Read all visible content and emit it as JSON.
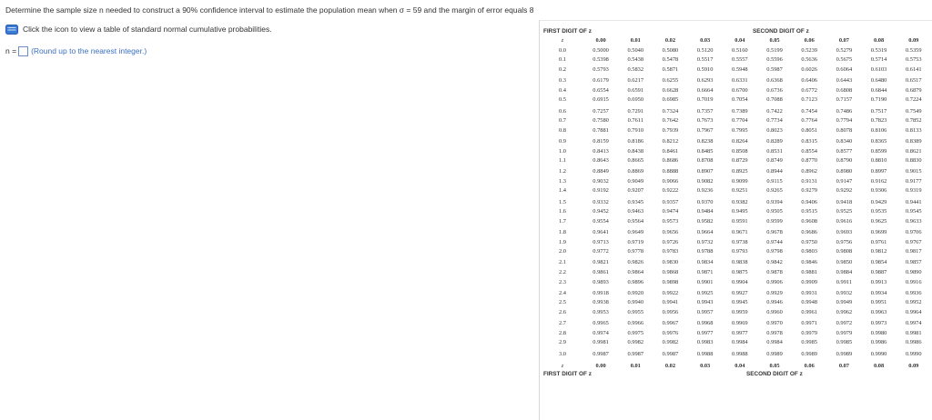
{
  "question": "Determine the sample size n needed to construct a 90% confidence interval to estimate the population mean when σ = 59 and the margin of error equals 8",
  "hint": "Click the icon to view a table of standard normal cumulative probabilities.",
  "answer": {
    "label": "n =",
    "value": "",
    "hint": "(Round up to the nearest integer.)"
  },
  "table": {
    "first_digit_label": "FIRST DIGIT OF z",
    "second_digit_label": "SECOND DIGIT OF z",
    "z_symbol": "z",
    "columns": [
      "0.00",
      "0.01",
      "0.02",
      "0.03",
      "0.04",
      "0.05",
      "0.06",
      "0.07",
      "0.08",
      "0.09"
    ],
    "rows": [
      {
        "z": "0.0",
        "vals": [
          "0.5000",
          "0.5040",
          "0.5080",
          "0.5120",
          "0.5160",
          "0.5199",
          "0.5239",
          "0.5279",
          "0.5319",
          "0.5359"
        ]
      },
      {
        "z": "0.1",
        "vals": [
          "0.5398",
          "0.5438",
          "0.5478",
          "0.5517",
          "0.5557",
          "0.5596",
          "0.5636",
          "0.5675",
          "0.5714",
          "0.5753"
        ]
      },
      {
        "z": "0.2",
        "vals": [
          "0.5793",
          "0.5832",
          "0.5871",
          "0.5910",
          "0.5948",
          "0.5987",
          "0.6026",
          "0.6064",
          "0.6103",
          "0.6141"
        ]
      },
      {
        "z": "0.3",
        "vals": [
          "0.6179",
          "0.6217",
          "0.6255",
          "0.6293",
          "0.6331",
          "0.6368",
          "0.6406",
          "0.6443",
          "0.6480",
          "0.6517"
        ]
      },
      {
        "z": "0.4",
        "vals": [
          "0.6554",
          "0.6591",
          "0.6628",
          "0.6664",
          "0.6700",
          "0.6736",
          "0.6772",
          "0.6808",
          "0.6844",
          "0.6879"
        ]
      },
      {
        "z": "0.5",
        "vals": [
          "0.6915",
          "0.6950",
          "0.6985",
          "0.7019",
          "0.7054",
          "0.7088",
          "0.7123",
          "0.7157",
          "0.7190",
          "0.7224"
        ]
      },
      {
        "z": "0.6",
        "vals": [
          "0.7257",
          "0.7291",
          "0.7324",
          "0.7357",
          "0.7389",
          "0.7422",
          "0.7454",
          "0.7486",
          "0.7517",
          "0.7549"
        ]
      },
      {
        "z": "0.7",
        "vals": [
          "0.7580",
          "0.7611",
          "0.7642",
          "0.7673",
          "0.7704",
          "0.7734",
          "0.7764",
          "0.7794",
          "0.7823",
          "0.7852"
        ]
      },
      {
        "z": "0.8",
        "vals": [
          "0.7881",
          "0.7910",
          "0.7939",
          "0.7967",
          "0.7995",
          "0.8023",
          "0.8051",
          "0.8078",
          "0.8106",
          "0.8133"
        ]
      },
      {
        "z": "0.9",
        "vals": [
          "0.8159",
          "0.8186",
          "0.8212",
          "0.8238",
          "0.8264",
          "0.8289",
          "0.8315",
          "0.8340",
          "0.8365",
          "0.8389"
        ]
      },
      {
        "z": "1.0",
        "vals": [
          "0.8413",
          "0.8438",
          "0.8461",
          "0.8485",
          "0.8508",
          "0.8531",
          "0.8554",
          "0.8577",
          "0.8599",
          "0.8621"
        ]
      },
      {
        "z": "1.1",
        "vals": [
          "0.8643",
          "0.8665",
          "0.8686",
          "0.8708",
          "0.8729",
          "0.8749",
          "0.8770",
          "0.8790",
          "0.8810",
          "0.8830"
        ]
      },
      {
        "z": "1.2",
        "vals": [
          "0.8849",
          "0.8869",
          "0.8888",
          "0.8907",
          "0.8925",
          "0.8944",
          "0.8962",
          "0.8980",
          "0.8997",
          "0.9015"
        ]
      },
      {
        "z": "1.3",
        "vals": [
          "0.9032",
          "0.9049",
          "0.9066",
          "0.9082",
          "0.9099",
          "0.9115",
          "0.9131",
          "0.9147",
          "0.9162",
          "0.9177"
        ]
      },
      {
        "z": "1.4",
        "vals": [
          "0.9192",
          "0.9207",
          "0.9222",
          "0.9236",
          "0.9251",
          "0.9265",
          "0.9279",
          "0.9292",
          "0.9306",
          "0.9319"
        ]
      },
      {
        "z": "1.5",
        "vals": [
          "0.9332",
          "0.9345",
          "0.9357",
          "0.9370",
          "0.9382",
          "0.9394",
          "0.9406",
          "0.9418",
          "0.9429",
          "0.9441"
        ]
      },
      {
        "z": "1.6",
        "vals": [
          "0.9452",
          "0.9463",
          "0.9474",
          "0.9484",
          "0.9495",
          "0.9505",
          "0.9515",
          "0.9525",
          "0.9535",
          "0.9545"
        ]
      },
      {
        "z": "1.7",
        "vals": [
          "0.9554",
          "0.9564",
          "0.9573",
          "0.9582",
          "0.9591",
          "0.9599",
          "0.9608",
          "0.9616",
          "0.9625",
          "0.9633"
        ]
      },
      {
        "z": "1.8",
        "vals": [
          "0.9641",
          "0.9649",
          "0.9656",
          "0.9664",
          "0.9671",
          "0.9678",
          "0.9686",
          "0.9693",
          "0.9699",
          "0.9706"
        ]
      },
      {
        "z": "1.9",
        "vals": [
          "0.9713",
          "0.9719",
          "0.9726",
          "0.9732",
          "0.9738",
          "0.9744",
          "0.9750",
          "0.9756",
          "0.9761",
          "0.9767"
        ]
      },
      {
        "z": "2.0",
        "vals": [
          "0.9772",
          "0.9778",
          "0.9783",
          "0.9788",
          "0.9793",
          "0.9798",
          "0.9803",
          "0.9808",
          "0.9812",
          "0.9817"
        ]
      },
      {
        "z": "2.1",
        "vals": [
          "0.9821",
          "0.9826",
          "0.9830",
          "0.9834",
          "0.9838",
          "0.9842",
          "0.9846",
          "0.9850",
          "0.9854",
          "0.9857"
        ]
      },
      {
        "z": "2.2",
        "vals": [
          "0.9861",
          "0.9864",
          "0.9868",
          "0.9871",
          "0.9875",
          "0.9878",
          "0.9881",
          "0.9884",
          "0.9887",
          "0.9890"
        ]
      },
      {
        "z": "2.3",
        "vals": [
          "0.9893",
          "0.9896",
          "0.9898",
          "0.9901",
          "0.9904",
          "0.9906",
          "0.9909",
          "0.9911",
          "0.9913",
          "0.9916"
        ]
      },
      {
        "z": "2.4",
        "vals": [
          "0.9918",
          "0.9920",
          "0.9922",
          "0.9925",
          "0.9927",
          "0.9929",
          "0.9931",
          "0.9932",
          "0.9934",
          "0.9936"
        ]
      },
      {
        "z": "2.5",
        "vals": [
          "0.9938",
          "0.9940",
          "0.9941",
          "0.9943",
          "0.9945",
          "0.9946",
          "0.9948",
          "0.9949",
          "0.9951",
          "0.9952"
        ]
      },
      {
        "z": "2.6",
        "vals": [
          "0.9953",
          "0.9955",
          "0.9956",
          "0.9957",
          "0.9959",
          "0.9960",
          "0.9961",
          "0.9962",
          "0.9963",
          "0.9964"
        ]
      },
      {
        "z": "2.7",
        "vals": [
          "0.9965",
          "0.9966",
          "0.9967",
          "0.9968",
          "0.9969",
          "0.9970",
          "0.9971",
          "0.9972",
          "0.9973",
          "0.9974"
        ]
      },
      {
        "z": "2.8",
        "vals": [
          "0.9974",
          "0.9975",
          "0.9976",
          "0.9977",
          "0.9977",
          "0.9978",
          "0.9979",
          "0.9979",
          "0.9980",
          "0.9981"
        ]
      },
      {
        "z": "2.9",
        "vals": [
          "0.9981",
          "0.9982",
          "0.9982",
          "0.9983",
          "0.9984",
          "0.9984",
          "0.9985",
          "0.9985",
          "0.9986",
          "0.9986"
        ]
      },
      {
        "z": "3.0",
        "vals": [
          "0.9987",
          "0.9987",
          "0.9987",
          "0.9988",
          "0.9988",
          "0.9989",
          "0.9989",
          "0.9989",
          "0.9990",
          "0.9990"
        ]
      }
    ]
  },
  "colors": {
    "icon_blue": "#3a7bd5",
    "hint_blue": "#3a6fc4",
    "input_border": "#6b8fc2"
  }
}
